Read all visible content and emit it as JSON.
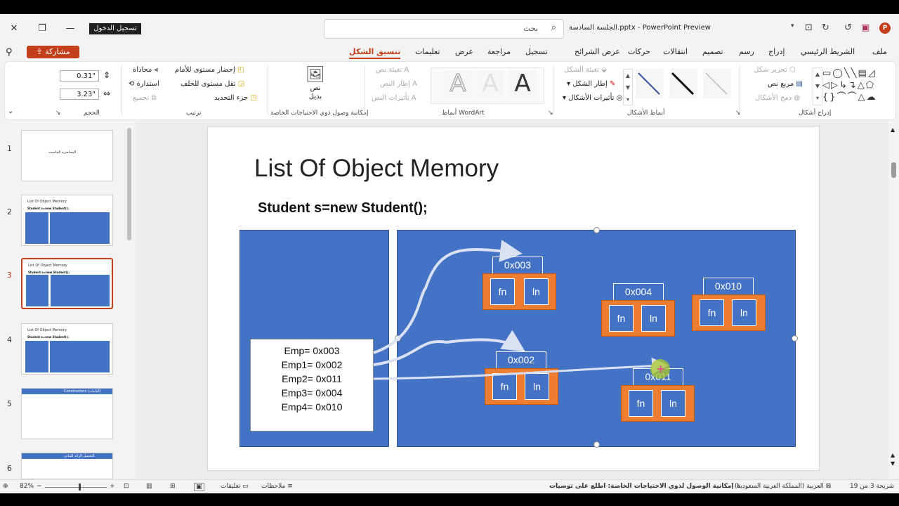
{
  "titlebar": {
    "sign_in": "تسجيل الدخول",
    "search_placeholder": "بحث",
    "doc_title": "الجلسة السادسة.pptx - PowerPoint Preview",
    "logo_letter": "P"
  },
  "tabs": {
    "share": "مشاركة",
    "items": [
      "ملف",
      "الشريط الرئيسي",
      "إدراج",
      "رسم",
      "تصميم",
      "انتقالات",
      "حركات",
      "عرض الشرائح",
      "تسجيل",
      "مراجعة",
      "عرض",
      "تعليمات",
      "تنسيق الشكل"
    ]
  },
  "ribbon": {
    "size": {
      "height": "0.31\"",
      "width": "3.23\"",
      "label": "الحجم"
    },
    "arrange": {
      "bring_forward": "إحضار مستوى للأمام",
      "send_backward": "نقل مستوى للخلف",
      "selection_pane": "جزء التحديد",
      "align": "محاذاة",
      "group": "تجميع",
      "rotate": "استدارة",
      "label": "ترتيب"
    },
    "accessibility": {
      "alt_text": "نص بديل",
      "label": "إمكانية وصول ذوي الاحتياجات الخاصة"
    },
    "wordart": {
      "text_fill": "تعبئة نص",
      "text_outline": "إطار النص",
      "text_effects": "تأثيرات النص",
      "label": "أنماط WordArt",
      "letter": "A"
    },
    "shape_styles": {
      "shape_fill": "تعبئة الشكل",
      "shape_outline": "إطار الشكل",
      "shape_effects": "تأثيرات الأشكال",
      "label": "أنماط الأشكال"
    },
    "insert_shapes": {
      "edit_shape": "تحرير شكل",
      "text_box": "مربع نص",
      "merge_shapes": "دمج الأشكال",
      "label": "إدراج أشكال"
    }
  },
  "thumbs": [
    {
      "num": "1",
      "title": "المحاضرة الخامسة",
      "sub": ""
    },
    {
      "num": "2",
      "title": "List Of Object Memory",
      "sub": "Student s=new Student();"
    },
    {
      "num": "3",
      "title": "List Of Object Memory",
      "sub": "Student s=new Student();"
    },
    {
      "num": "4",
      "title": "List Of Object Memory",
      "sub": "Student s=new Student();"
    },
    {
      "num": "5",
      "title": "Constructors (البانيات)",
      "sub": ""
    },
    {
      "num": "6",
      "title": "التحميل الزائد للبناني",
      "sub": ""
    }
  ],
  "slide": {
    "title": "List Of Object Memory",
    "code": "Student s=new Student();",
    "vars": [
      "Emp= 0x003",
      "Emp1= 0x002",
      "Emp2= 0x011",
      "Emp3= 0x004",
      "Emp4= 0x010"
    ],
    "objects": [
      {
        "addr": "0x003",
        "f1": "fn",
        "f2": "ln"
      },
      {
        "addr": "0x004",
        "f1": "fn",
        "f2": "ln"
      },
      {
        "addr": "0x010",
        "f1": "fn",
        "f2": "ln"
      },
      {
        "addr": "0x002",
        "f1": "fn",
        "f2": "ln"
      },
      {
        "addr": "0x011",
        "f1": "fn",
        "f2": "ln"
      }
    ]
  },
  "status": {
    "slide_of": "شريحة 3 من 19",
    "language": "العربية (المملكة العربية السعودية)",
    "accessibility": "إمكانية الوصول لذوي الاحتياجات الخاصة: اطلع على توصيات",
    "notes": "ملاحظات",
    "comments": "تعليقات",
    "zoom": "82%"
  },
  "colors": {
    "accent": "#c43e1c",
    "slide_blue": "#4472c4",
    "object_orange": "#ed7d31"
  }
}
